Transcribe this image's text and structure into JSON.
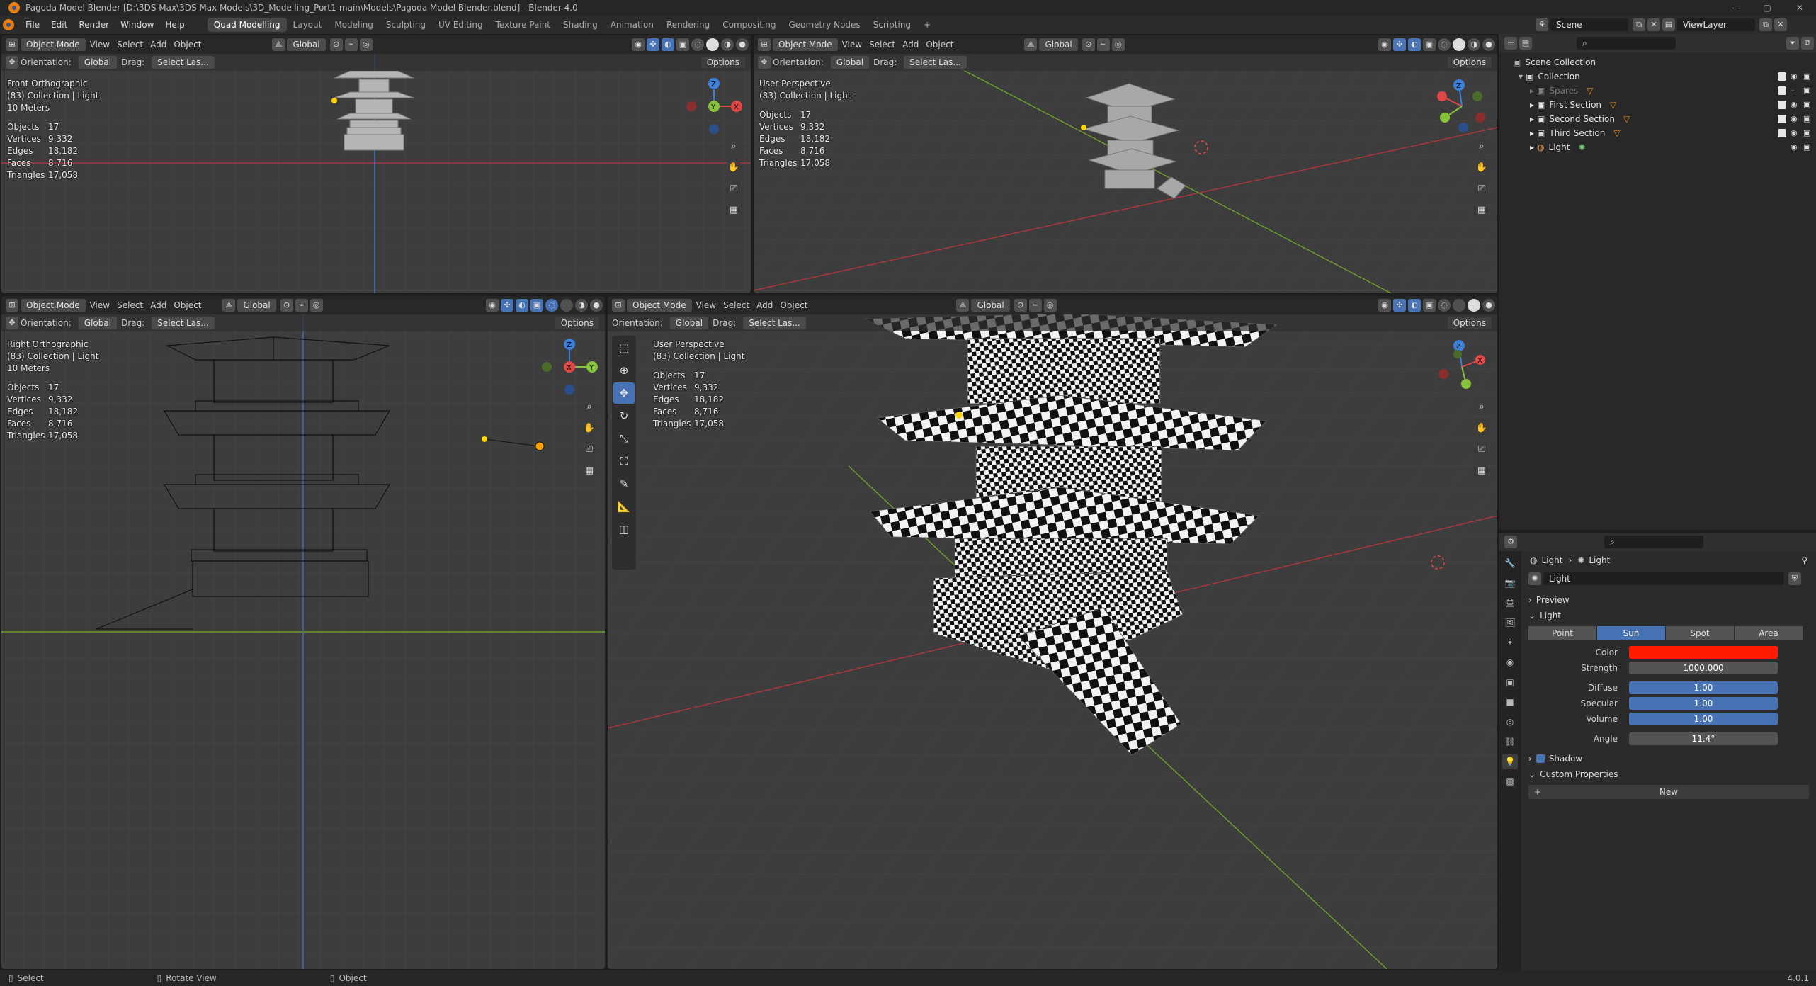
{
  "window": {
    "title": "Pagoda Model Blender [D:\\3DS Max\\3DS Max Models\\3D_Modelling_Port1-main\\Models\\Pagoda Model Blender.blend] - Blender 4.0",
    "minimize": "–",
    "maximize": "▢",
    "close": "✕"
  },
  "menu": {
    "items": [
      "File",
      "Edit",
      "Render",
      "Window",
      "Help"
    ],
    "workspaces": [
      "Quad Modelling",
      "Layout",
      "Modeling",
      "Sculpting",
      "UV Editing",
      "Texture Paint",
      "Shading",
      "Animation",
      "Rendering",
      "Compositing",
      "Geometry Nodes",
      "Scripting"
    ],
    "add_tab": "+",
    "scene": "Scene",
    "view_layer": "ViewLayer"
  },
  "viewport_header": {
    "mode": "Object Mode",
    "view": "View",
    "select": "Select",
    "add": "Add",
    "object": "Object",
    "transform": "Global",
    "orientation_label": "Orientation:",
    "orientation_value": "Global",
    "drag_label": "Drag:",
    "drag_value": "Select Las...",
    "options": "Options"
  },
  "viewports": [
    {
      "name": "Front Orthographic",
      "collection": "(83) Collection | Light",
      "scale": "10 Meters"
    },
    {
      "name": "User Perspective",
      "collection": "(83) Collection | Light",
      "scale": ""
    },
    {
      "name": "Right Orthographic",
      "collection": "(83) Collection | Light",
      "scale": "10 Meters"
    },
    {
      "name": "User Perspective",
      "collection": "(83) Collection | Light",
      "scale": ""
    }
  ],
  "stats": {
    "objects_label": "Objects",
    "objects": "17",
    "vertices_label": "Vertices",
    "vertices": "9,332",
    "edges_label": "Edges",
    "edges": "18,182",
    "faces_label": "Faces",
    "faces": "8,716",
    "triangles_label": "Triangles",
    "triangles": "17,058"
  },
  "outliner": {
    "root": "Scene Collection",
    "collection": "Collection",
    "items": [
      "Spares",
      "First Section",
      "Second Section",
      "Third Section",
      "Light"
    ]
  },
  "properties": {
    "breadcrumb_a": "Light",
    "breadcrumb_b": "Light",
    "datablock": "Light",
    "preview": "Preview",
    "light_section": "Light",
    "types": [
      "Point",
      "Sun",
      "Spot",
      "Area"
    ],
    "active_type": "Sun",
    "color_label": "Color",
    "color_value": "#ff1a00",
    "strength_label": "Strength",
    "strength": "1000.000",
    "diffuse_label": "Diffuse",
    "diffuse": "1.00",
    "specular_label": "Specular",
    "specular": "1.00",
    "volume_label": "Volume",
    "volume": "1.00",
    "angle_label": "Angle",
    "angle": "11.4°",
    "shadow": "Shadow",
    "custom_properties": "Custom Properties",
    "new_button": "New"
  },
  "statusbar": {
    "select": "Select",
    "rotate": "Rotate View",
    "object": "Object",
    "version": "4.0.1"
  },
  "colors": {
    "accent": "#4772b3",
    "x_axis": "#e04848",
    "y_axis": "#86c23a",
    "z_axis": "#3a7fd8",
    "light_color": "#ff1a00"
  }
}
